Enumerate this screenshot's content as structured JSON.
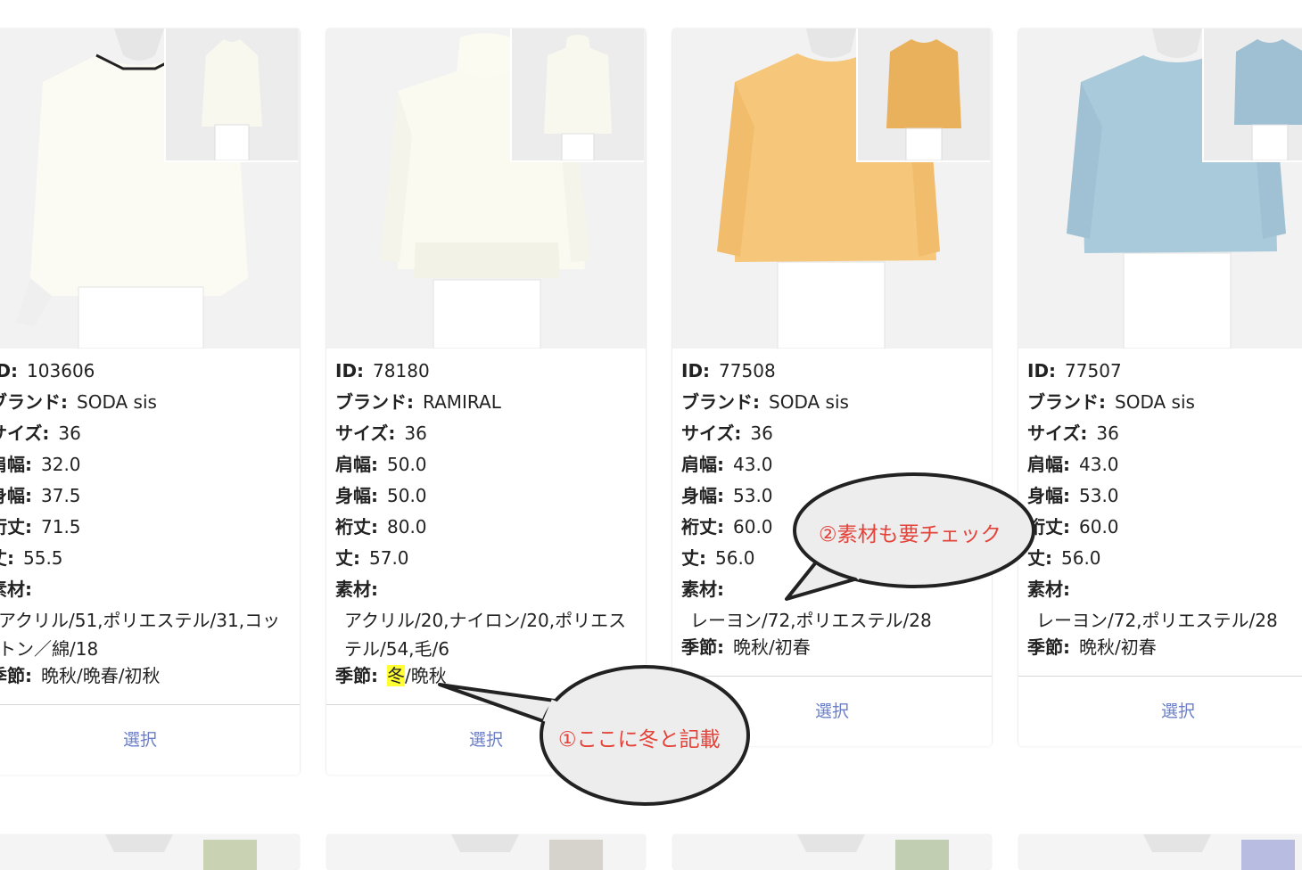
{
  "labels": {
    "id": "ID:",
    "brand": "ブランド:",
    "size": "サイズ:",
    "shoulder": "肩幅:",
    "body_width": "身幅:",
    "sleeve": "裄丈:",
    "length": "丈:",
    "material": "素材:",
    "season": "季節:"
  },
  "select_label": "選択",
  "colors": {
    "accent": "#6c7fc8",
    "highlight": "#ffff33",
    "annotation": "#e4433a"
  },
  "products": [
    {
      "id": "103606",
      "brand": "SODA sis",
      "size": "36",
      "shoulder": "32.0",
      "body_width": "37.5",
      "sleeve": "71.5",
      "length": "55.5",
      "material": "アクリル/51,ポリエステル/31,コットン／綿/18",
      "season_1": "晩秋/晩春/初秋",
      "season_2": ""
    },
    {
      "id": "78180",
      "brand": "RAMIRAL",
      "size": "36",
      "shoulder": "50.0",
      "body_width": "50.0",
      "sleeve": "80.0",
      "length": "57.0",
      "material": "アクリル/20,ナイロン/20,ポリエステル/54,毛/6",
      "season_1": "冬",
      "season_2": "/晩秋"
    },
    {
      "id": "77508",
      "brand": "SODA sis",
      "size": "36",
      "shoulder": "43.0",
      "body_width": "53.0",
      "sleeve": "60.0",
      "length": "56.0",
      "material": "レーヨン/72,ポリエステル/28",
      "season_1": "晩秋/初春",
      "season_2": ""
    },
    {
      "id": "77507",
      "brand": "SODA sis",
      "size": "36",
      "shoulder": "43.0",
      "body_width": "53.0",
      "sleeve": "60.0",
      "length": "56.0",
      "material": "レーヨン/72,ポリエステル/28",
      "season_1": "晩秋/初春",
      "season_2": ""
    }
  ],
  "annotations": {
    "note1": "①ここに冬と記載",
    "note2": "②素材も要チェック"
  }
}
